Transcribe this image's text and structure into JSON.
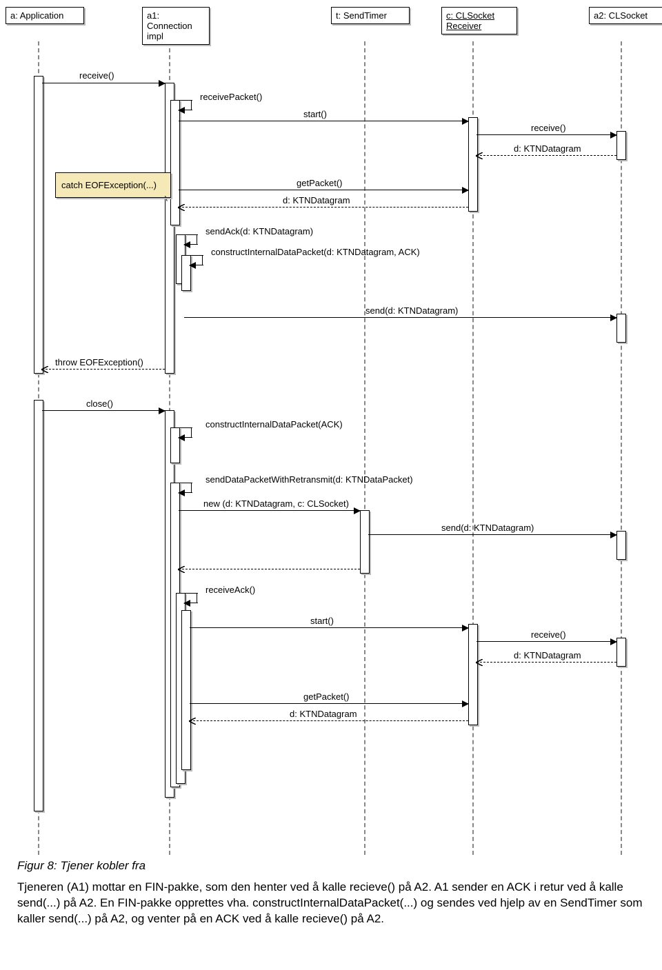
{
  "participants": {
    "app": {
      "title_l1": "a: Application",
      "title_l2": ""
    },
    "conn": {
      "title_l1": "a1:",
      "title_l2": "Connection",
      "title_l3": "impl"
    },
    "timer": {
      "title_l1": "t: SendTimer"
    },
    "recv": {
      "title_l1": "c: CLSocket",
      "title_l2": "Receiver"
    },
    "sock": {
      "title_l1": "a2: CLSocket"
    }
  },
  "note": {
    "text": "catch EOFException(...)"
  },
  "messages": {
    "m1": "receive()",
    "m2": "receivePacket()",
    "m3": "start()",
    "m4": "receive()",
    "m5": "d: KTNDatagram",
    "m6": "getPacket()",
    "m7": "d: KTNDatagram",
    "m8": "sendAck(d: KTNDatagram)",
    "m9": "constructInternalDataPacket(d: KTNDatagram, ACK)",
    "m10": "send(d: KTNDatagram)",
    "m11": "throw EOFException()",
    "m12": "close()",
    "m13": "constructInternalDataPacket(ACK)",
    "m14": "sendDataPacketWithRetransmit(d: KTNDataPacket)",
    "m15": "new (d: KTNDatagram, c: CLSocket)",
    "m16": "send(d: KTNDatagram)",
    "m17": "receiveAck()",
    "m18": "start()",
    "m19": "receive()",
    "m20": "d: KTNDatagram",
    "m21": "getPacket()",
    "m22": "d: KTNDatagram"
  },
  "caption": "Figur 8: Tjener kobler fra",
  "paragraph": "Tjeneren (A1) mottar en FIN-pakke, som den henter ved å kalle recieve() på A2. A1 sender en ACK i retur ved å kalle send(...) på A2. En FIN-pakke opprettes vha. constructInternalDataPacket(...) og sendes ved hjelp av en SendTimer som kaller send(...) på A2, og venter på en ACK ved å kalle recieve() på A2."
}
